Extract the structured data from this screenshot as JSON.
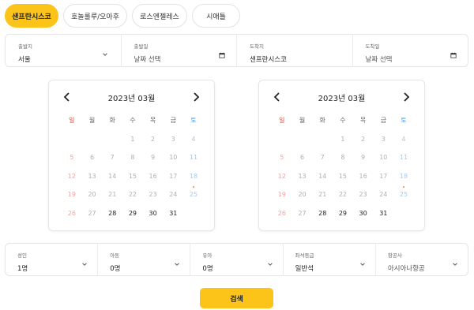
{
  "tabs": [
    {
      "label": "샌프란시스코",
      "active": true
    },
    {
      "label": "호놀룰루/오아후",
      "active": false
    },
    {
      "label": "로스엔젤레스",
      "active": false
    },
    {
      "label": "시애틀",
      "active": false
    }
  ],
  "search": {
    "departure": {
      "label": "출발지",
      "value": "서울"
    },
    "depart_date": {
      "label": "출발일",
      "value": "날짜 선택"
    },
    "arrival": {
      "label": "도착지",
      "value": "샌프란시스코"
    },
    "arrive_date": {
      "label": "도착일",
      "value": "날짜 선택"
    }
  },
  "calendars": [
    {
      "title": "2023년 03월",
      "weekdays": [
        "일",
        "월",
        "화",
        "수",
        "목",
        "금",
        "토"
      ],
      "leading_blanks": 3,
      "days": 31,
      "past_until": 27,
      "dot_days": [
        25
      ]
    },
    {
      "title": "2023년 03월",
      "weekdays": [
        "일",
        "월",
        "화",
        "수",
        "목",
        "금",
        "토"
      ],
      "leading_blanks": 3,
      "days": 31,
      "past_until": 27,
      "dot_days": [
        25
      ]
    }
  ],
  "passengers": {
    "adult": {
      "label": "성인",
      "value": "1명"
    },
    "child": {
      "label": "아동",
      "value": "0명"
    },
    "infant": {
      "label": "유아",
      "value": "0명"
    },
    "seat_class": {
      "label": "좌석등급",
      "value": "일반석"
    },
    "airline": {
      "label": "항공사",
      "value": "아시아나항공"
    }
  },
  "search_button": "검색",
  "colors": {
    "accent": "#fcc419",
    "sunday": "#e74c3c",
    "saturday": "#4a90e2",
    "dot": "#ff7a45"
  }
}
